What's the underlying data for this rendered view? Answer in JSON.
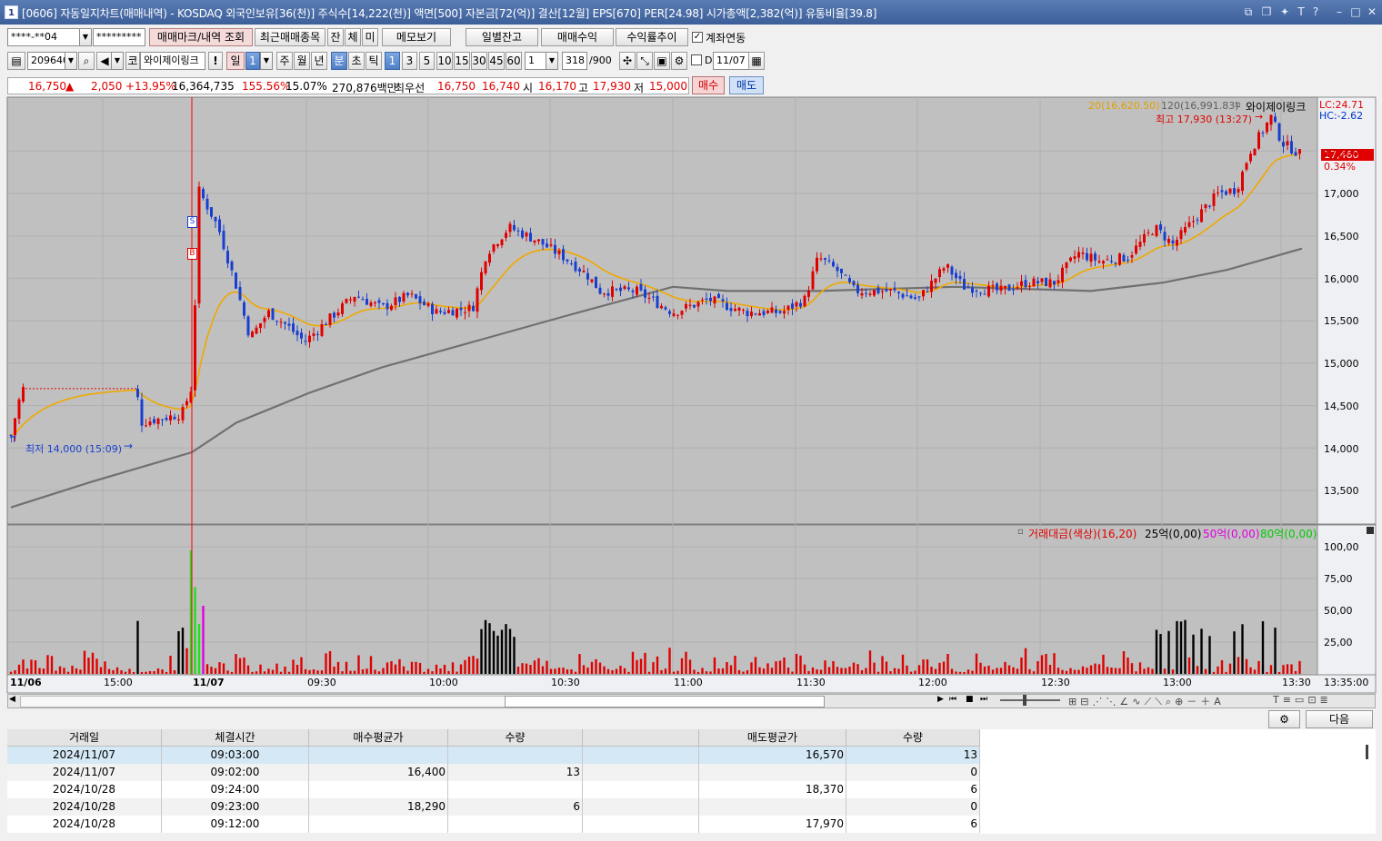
{
  "window": {
    "number": "1",
    "title": "[0606] 자동일지차트(매매내역) - KOSDAQ 외국인보유[36(천)] 주식수[14,222(천)] 액면[500] 자본금[72(억)] 결산[12월] EPS[670] PER[24.98] 시가총액[2,382(억)] 유통비율[39.8]"
  },
  "toolbar1": {
    "account": "****-**04",
    "password": "*********",
    "trade_mark_label": "매매마크/내역 조회",
    "recent_label": "최근매매종목",
    "jan": "잔",
    "che": "체",
    "mi": "미",
    "memo_label": "메모보기",
    "daily_balance": "일별잔고",
    "trade_profit": "매매수익",
    "profit_trend": "수익률추이",
    "account_link_label": "계좌연동",
    "account_link_checked": true
  },
  "toolbar2": {
    "code": "209640",
    "market": "코",
    "stock_name": "와이제이링크",
    "periods": [
      "일",
      "주",
      "월",
      "년",
      "분",
      "초",
      "틱"
    ],
    "period_count": "1",
    "minute_options": [
      "1",
      "3",
      "5",
      "10",
      "15",
      "30",
      "45",
      "60"
    ],
    "interval_value": "1",
    "count_value": "318",
    "count_max": "/900",
    "d_label": "D",
    "date": "11/07"
  },
  "quote": {
    "price": "16,750",
    "change": "2,050",
    "change_pct": "+13.95%",
    "volume": "16,364,735",
    "vol_ratio": "155.56%",
    "turnover": "15.07%",
    "amount": "270,876백만",
    "best_label": "최우선",
    "best_ask": "16,750",
    "best_bid": "16,740",
    "open_label": "시",
    "open": "16,170",
    "high_label": "고",
    "high": "17,930",
    "low_label": "저",
    "low": "15,000",
    "buy_label": "매수",
    "sell_label": "매도"
  },
  "price_chart": {
    "legend": {
      "ma20": "20(16,620.50)",
      "ma120": "120(16,991.83)",
      "name": "와이제이링크"
    },
    "lc": "LC:24.71",
    "hc": "HC:-2.62",
    "current_price_tag": "17,460",
    "current_pct_tag": "0.34%",
    "high_note": "최고 17,930 (13:27)",
    "low_note": "최저 14,000 (15:09)",
    "markers": [
      "S",
      "B"
    ],
    "y_ticks": [
      "17,500",
      "17,000",
      "16,500",
      "16,000",
      "15,500",
      "15,000",
      "14,500",
      "14,000",
      "13,500"
    ]
  },
  "volume_chart": {
    "legend": {
      "title": "거래대금(색상)(16,20)",
      "l25": "25억(0,00)",
      "l50": "50억(0,00)",
      "l80": "80억(0,00)"
    },
    "y_ticks": [
      "100,00",
      "75,00",
      "50,00",
      "25,00"
    ]
  },
  "x_axis": {
    "labels": [
      "11/06",
      "15:00",
      "11/07",
      "09:30",
      "10:00",
      "10:30",
      "11:00",
      "11:30",
      "12:00",
      "12:30",
      "13:00",
      "13:30"
    ],
    "end_time": "13:35:00"
  },
  "bottom_toolbar": {
    "next_label": "다음"
  },
  "trade_table": {
    "headers": [
      "거래일",
      "체결시간",
      "매수평균가",
      "수량",
      "",
      "매도평균가",
      "수량"
    ],
    "rows": [
      [
        "2024/11/07",
        "09:03:00",
        "",
        "",
        "",
        "16,570",
        "13"
      ],
      [
        "2024/11/07",
        "09:02:00",
        "16,400",
        "13",
        "",
        "",
        "0"
      ],
      [
        "2024/10/28",
        "09:24:00",
        "",
        "",
        "",
        "18,370",
        "6"
      ],
      [
        "2024/10/28",
        "09:23:00",
        "18,290",
        "6",
        "",
        "",
        "0"
      ],
      [
        "2024/10/28",
        "09:12:00",
        "",
        "",
        "",
        "17,970",
        "6"
      ]
    ]
  },
  "colors": {
    "up": "#e00000",
    "down": "#1a3fd0",
    "ma20": "#f0a800",
    "ma120": "#707070",
    "chart_bg": "#c0c0c0",
    "title_bar": "#4a6ca8"
  }
}
